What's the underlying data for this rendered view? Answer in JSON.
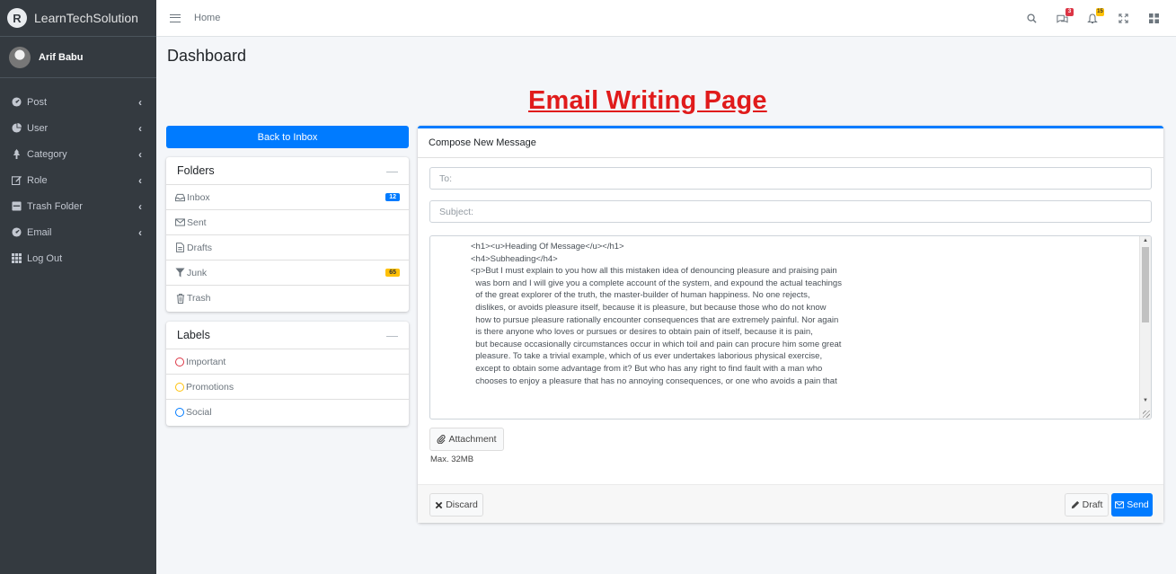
{
  "brand": {
    "name": "LearnTechSolution",
    "logo_letter": "R"
  },
  "user": {
    "name": "Arif Babu"
  },
  "sidebar": {
    "items": [
      {
        "label": "Post",
        "icon": "tachometer-icon",
        "has_submenu": true
      },
      {
        "label": "User",
        "icon": "chart-pie-icon",
        "has_submenu": true
      },
      {
        "label": "Category",
        "icon": "tree-icon",
        "has_submenu": true
      },
      {
        "label": "Role",
        "icon": "edit-icon",
        "has_submenu": true
      },
      {
        "label": "Trash Folder",
        "icon": "trash-folder-icon",
        "has_submenu": true
      },
      {
        "label": "Email",
        "icon": "tachometer-icon",
        "has_submenu": true
      },
      {
        "label": "Log Out",
        "icon": "grid-icon",
        "has_submenu": false
      }
    ]
  },
  "topbar": {
    "home": "Home",
    "messages_badge": "3",
    "notifications_badge": "15"
  },
  "page": {
    "title": "Dashboard",
    "banner": "Email Writing Page"
  },
  "back_button": "Back to Inbox",
  "folders": {
    "title": "Folders",
    "collapse_symbol": "—",
    "items": [
      {
        "label": "Inbox",
        "icon": "inbox-icon",
        "count": "12",
        "count_color": "#007bff"
      },
      {
        "label": "Sent",
        "icon": "envelope-icon",
        "count": null
      },
      {
        "label": "Drafts",
        "icon": "file-icon",
        "count": null
      },
      {
        "label": "Junk",
        "icon": "filter-icon",
        "count": "65",
        "count_color": "#ffc107"
      },
      {
        "label": "Trash",
        "icon": "trash-icon",
        "count": null
      }
    ]
  },
  "labels": {
    "title": "Labels",
    "collapse_symbol": "—",
    "items": [
      {
        "label": "Important",
        "color": "#dc3545"
      },
      {
        "label": "Promotions",
        "color": "#ffc107"
      },
      {
        "label": "Social",
        "color": "#007bff"
      }
    ]
  },
  "compose": {
    "title": "Compose New Message",
    "to_placeholder": "To:",
    "subject_placeholder": "Subject:",
    "body": "<h1><u>Heading Of Message</u></h1>\n<h4>Subheading</h4>\n<p>But I must explain to you how all this mistaken idea of denouncing pleasure and praising pain\n  was born and I will give you a complete account of the system, and expound the actual teachings\n  of the great explorer of the truth, the master-builder of human happiness. No one rejects,\n  dislikes, or avoids pleasure itself, because it is pleasure, but because those who do not know\n  how to pursue pleasure rationally encounter consequences that are extremely painful. Nor again\n  is there anyone who loves or pursues or desires to obtain pain of itself, because it is pain,\n  but because occasionally circumstances occur in which toil and pain can procure him some great\n  pleasure. To take a trivial example, which of us ever undertakes laborious physical exercise,\n  except to obtain some advantage from it? But who has any right to find fault with a man who\n  chooses to enjoy a pleasure that has no annoying consequences, or one who avoids a pain that",
    "attachment_label": "Attachment",
    "max_size": "Max. 32MB",
    "discard_label": "Discard",
    "draft_label": "Draft",
    "send_label": "Send"
  },
  "colors": {
    "primary": "#007bff",
    "sidebar_bg": "#343a40",
    "banner": "#e01b1b"
  }
}
